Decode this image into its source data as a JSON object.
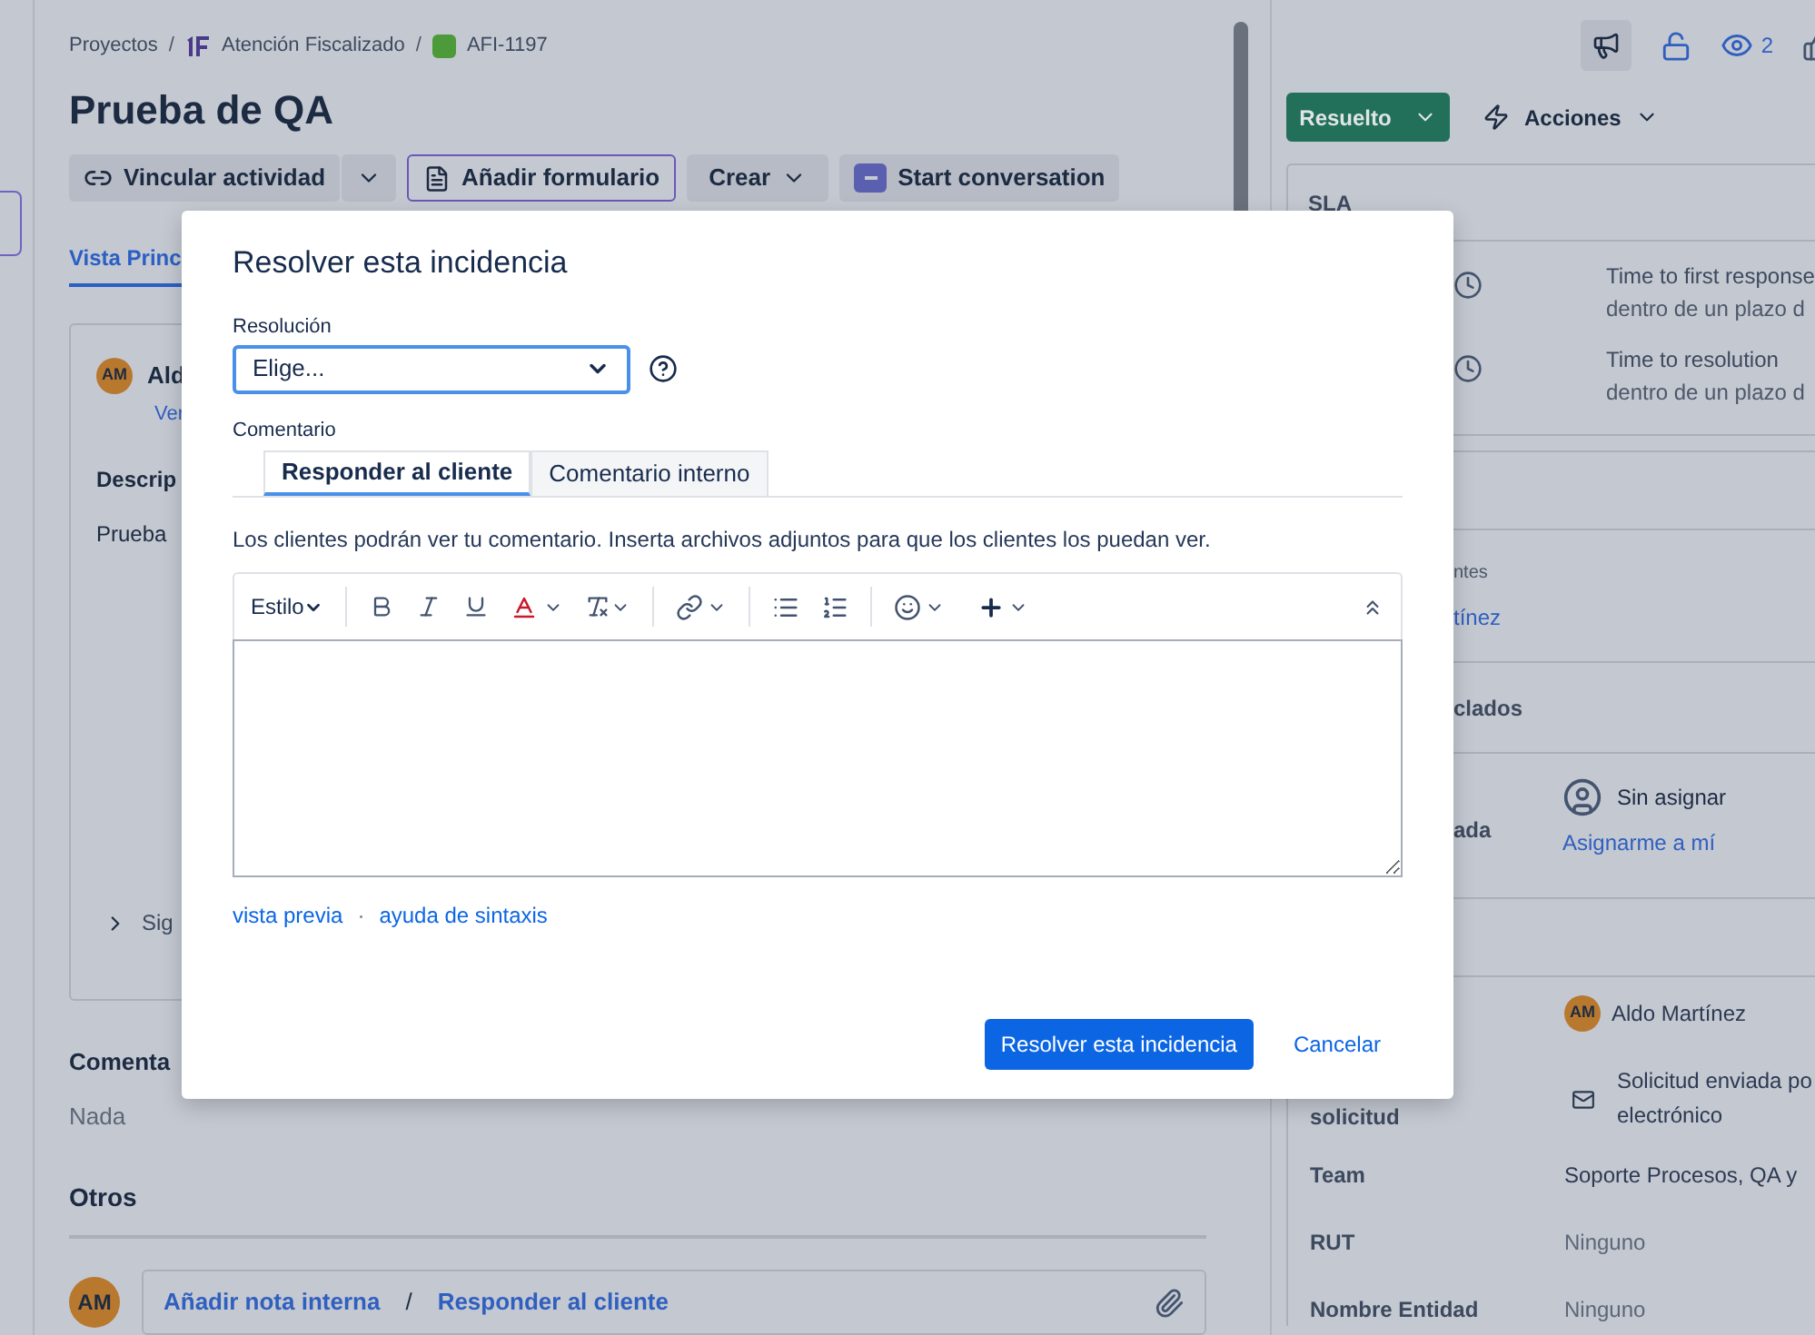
{
  "breadcrumbs": [
    {
      "label": "Proyectos",
      "kind": "text",
      "separator": "/"
    },
    {
      "label": "Atención Fiscalizado",
      "kind": "project",
      "separator": "/"
    },
    {
      "label": "AFI-1197",
      "kind": "issue"
    }
  ],
  "title": "Prueba de QA",
  "actions": [
    {
      "label": "Vincular actividad",
      "kind": "split"
    },
    {
      "label": "Añadir formulario",
      "kind": "outlined"
    },
    {
      "label": "Crear",
      "kind": "menu"
    },
    {
      "label": "Start conversation",
      "kind": "teams"
    }
  ],
  "tabs": [
    {
      "label": "Vista Princ",
      "selected": true
    }
  ],
  "description_card": {
    "avatar": "AM",
    "author": "Ald",
    "link": "Ver",
    "heading": "Descrip",
    "text": "Prueba",
    "section": "Sig"
  },
  "comments": {
    "heading": "Comenta",
    "text": "Nada"
  },
  "other": {
    "heading": "Otros"
  },
  "composer": {
    "avatar": "AM",
    "internal": "Añadir nota interna",
    "separator": "/",
    "reply": "Responder al cliente"
  },
  "side": {
    "watchers": "2",
    "status": "Resuelto",
    "actions": "Acciones",
    "sla": {
      "title": "SLA",
      "items": [
        {
          "name": "Time to first response",
          "status": "dentro de un plazo d"
        },
        {
          "name": "Time to resolution",
          "status": "dentro de un plazo d"
        }
      ]
    },
    "participants": {
      "label": "ntes",
      "value": "tínez"
    },
    "details_heading": "clados",
    "assignee": {
      "label": "ada",
      "value": "Sin asignar",
      "link": "Asignarme a mí"
    },
    "fields": [
      {
        "kind": "person",
        "avatar": "AM",
        "value": "Aldo Martínez"
      },
      {
        "kind": "channel",
        "label": "solicitud",
        "lines": [
          "Solicitud enviada po",
          "electrónico"
        ]
      },
      {
        "kind": "text",
        "label": "Team",
        "value": "Soporte Procesos, QA y"
      },
      {
        "kind": "empty",
        "label": "RUT",
        "value": "Ninguno"
      },
      {
        "kind": "empty",
        "label": "Nombre Entidad",
        "value": "Ninguno"
      }
    ]
  },
  "modal": {
    "title": "Resolver esta incidencia",
    "resolution": {
      "label": "Resolución",
      "value": "Elige..."
    },
    "comment": {
      "label": "Comentario",
      "tabs": [
        {
          "label": "Responder al cliente",
          "selected": true
        },
        {
          "label": "Comentario interno",
          "selected": false
        }
      ],
      "note": "Los clientes podrán ver tu comentario. Inserta archivos adjuntos para que los clientes los puedan ver.",
      "style": "Estilo",
      "links": [
        {
          "label": "vista previa"
        },
        {
          "label": "ayuda de sintaxis"
        }
      ],
      "link_separator": "·"
    },
    "buttons": [
      {
        "label": "Resolver esta incidencia",
        "kind": "primary"
      },
      {
        "label": "Cancelar",
        "kind": "link"
      }
    ]
  }
}
